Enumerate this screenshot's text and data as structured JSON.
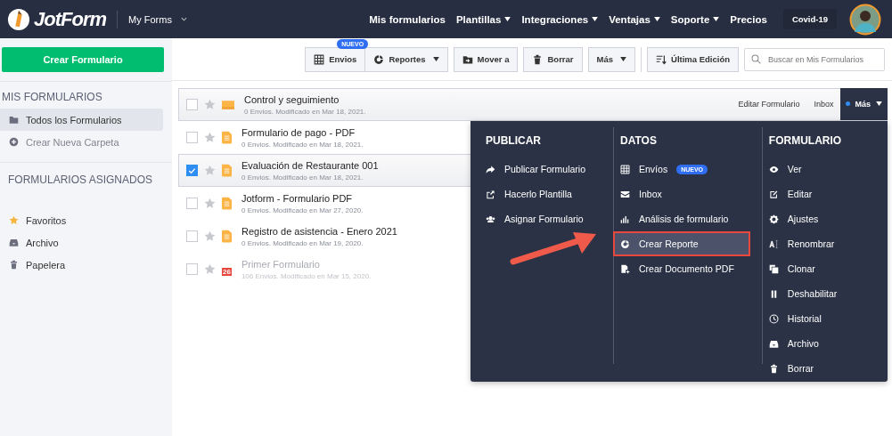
{
  "header": {
    "logo": "JotForm",
    "workspace": "My Forms",
    "nav": [
      {
        "label": "Mis formularios",
        "dropdown": false
      },
      {
        "label": "Plantillas",
        "dropdown": true
      },
      {
        "label": "Integraciones",
        "dropdown": true
      },
      {
        "label": "Ventajas",
        "dropdown": true
      },
      {
        "label": "Soporte",
        "dropdown": true
      },
      {
        "label": "Precios",
        "dropdown": false
      }
    ],
    "pill": "Covid-19"
  },
  "sidebar": {
    "create_button": "Crear Formulario",
    "sections": [
      {
        "title": "MIS FORMULARIOS",
        "items": [
          {
            "label": "Todos los Formularios",
            "kind": "folder",
            "selected": true,
            "disabled": false
          },
          {
            "label": "Crear Nueva Carpeta",
            "kind": "plus",
            "selected": false,
            "disabled": true
          }
        ]
      },
      {
        "title": "FORMULARIOS ASIGNADOS",
        "items": [
          {
            "label": "Favoritos",
            "kind": "star",
            "selected": false,
            "disabled": false
          },
          {
            "label": "Archivo",
            "kind": "inbox",
            "selected": false,
            "disabled": false
          },
          {
            "label": "Papelera",
            "kind": "trash",
            "selected": false,
            "disabled": false
          }
        ]
      }
    ]
  },
  "toolbar": {
    "groups": [
      [
        {
          "label": "Envios",
          "kind": "grid",
          "badge": "NUEVO",
          "dropdown": false
        },
        {
          "label": "Reportes",
          "kind": "report",
          "dropdown": true
        }
      ],
      [
        {
          "label": "Mover a",
          "kind": "move",
          "dropdown": false
        }
      ],
      [
        {
          "label": "Borrar",
          "kind": "trash",
          "dropdown": false
        }
      ],
      [
        {
          "label": "Más",
          "kind": "plain",
          "dropdown": true
        }
      ],
      [
        {
          "label": "Última Edición",
          "kind": "sort",
          "dropdown": false
        }
      ]
    ],
    "search": {
      "placeholder": "Buscar en Mis Formularios"
    }
  },
  "forms": [
    {
      "title": "Control y seguimiento",
      "meta": "0 Envios. Modificado en Mar 18, 2021.",
      "checked": false,
      "selected": true,
      "disabled": false,
      "kind": "block",
      "actions": [
        "Editar Formulario",
        "Inbox"
      ],
      "more": "Más"
    },
    {
      "title": "Formulario de pago - PDF",
      "meta": "0 Envios. Modificado en Mar 18, 2021.",
      "checked": false,
      "selected": false,
      "disabled": false,
      "kind": "doc"
    },
    {
      "title": "Evaluación de Restaurante 001",
      "meta": "0 Envios. Modificado en Mar 18, 2021.",
      "checked": true,
      "selected": true,
      "disabled": false,
      "kind": "doc"
    },
    {
      "title": "Jotform - Formulario PDF",
      "meta": "0 Envios. Modificado en Mar 27, 2020.",
      "checked": false,
      "selected": false,
      "disabled": false,
      "kind": "doc"
    },
    {
      "title": "Registro de asistencia - Enero 2021",
      "meta": "0 Envios. Modificado en Mar 19, 2020.",
      "checked": false,
      "selected": false,
      "disabled": false,
      "kind": "doc"
    },
    {
      "title": "Primer Formulario",
      "meta": "106 Envios. Modificado en Mar 15, 2020.",
      "checked": false,
      "selected": false,
      "disabled": true,
      "kind": "calendar",
      "date": "26"
    }
  ],
  "menu": [
    {
      "title": "PUBLICAR",
      "items": [
        {
          "label": "Publicar Formulario",
          "kind": "share",
          "highlighted": false
        },
        {
          "label": "Hacerlo Plantilla",
          "kind": "export",
          "highlighted": false
        },
        {
          "label": "Asignar Formulario",
          "kind": "users",
          "highlighted": false
        }
      ]
    },
    {
      "title": "DATOS",
      "items": [
        {
          "label": "Envíos",
          "kind": "grid",
          "badge": "NUEVO",
          "highlighted": false
        },
        {
          "label": "Inbox",
          "kind": "envelope",
          "highlighted": false
        },
        {
          "label": "Análisis de formulario",
          "kind": "chart",
          "highlighted": false
        },
        {
          "label": "Crear Reporte",
          "kind": "report",
          "highlighted": true
        },
        {
          "label": "Crear Documento PDF",
          "kind": "pdf",
          "highlighted": false
        }
      ]
    },
    {
      "title": "FORMULARIO",
      "items": [
        {
          "label": "Ver",
          "kind": "eye",
          "highlighted": false
        },
        {
          "label": "Editar",
          "kind": "edit",
          "highlighted": false
        },
        {
          "label": "Ajustes",
          "kind": "gear",
          "highlighted": false
        },
        {
          "label": "Renombrar",
          "kind": "rename",
          "highlighted": false
        },
        {
          "label": "Clonar",
          "kind": "copy",
          "highlighted": false
        },
        {
          "label": "Deshabilitar",
          "kind": "pause",
          "highlighted": false
        },
        {
          "label": "Historial",
          "kind": "clock",
          "highlighted": false
        },
        {
          "label": "Archivo",
          "kind": "inbox",
          "highlighted": false
        },
        {
          "label": "Borrar",
          "kind": "trash",
          "highlighted": false
        }
      ]
    }
  ]
}
